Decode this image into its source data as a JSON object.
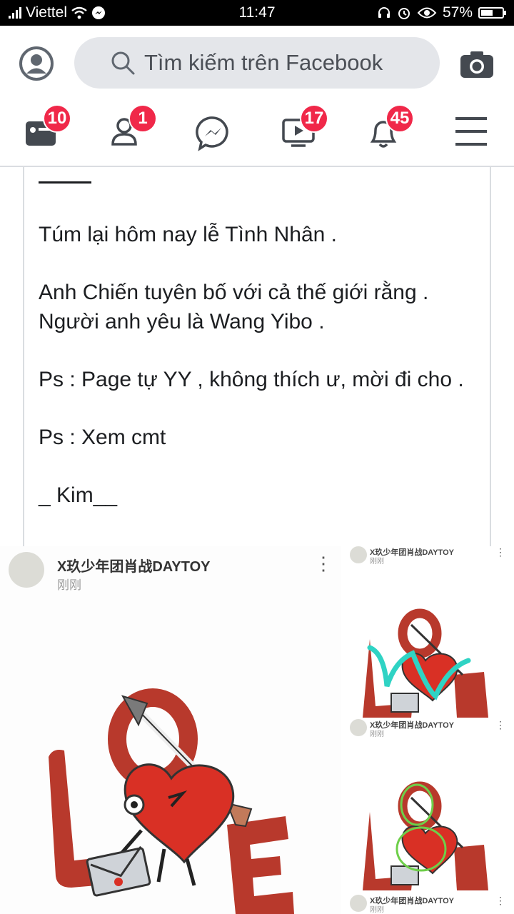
{
  "status_bar": {
    "carrier": "Viettel",
    "time": "11:47",
    "battery_percent": "57%",
    "battery_level": 0.57,
    "icons": [
      "signal-icon",
      "wifi-icon",
      "messenger-status-icon",
      "headset-icon",
      "alarm-icon",
      "eye-icon",
      "battery-icon"
    ]
  },
  "search": {
    "placeholder": "Tìm kiếm trên Facebook"
  },
  "nav": {
    "items": [
      {
        "name": "news-feed",
        "badge": "10"
      },
      {
        "name": "friends",
        "badge": "1"
      },
      {
        "name": "messenger",
        "badge": ""
      },
      {
        "name": "watch",
        "badge": "17"
      },
      {
        "name": "notifications",
        "badge": "45"
      },
      {
        "name": "menu",
        "badge": ""
      }
    ],
    "accent": "#f02849"
  },
  "post": {
    "paragraphs": [
      "Túm lại hôm nay lễ Tình Nhân .",
      "Anh Chiến tuyên bố với cả thế giới rằng .\nNgười anh yêu là Wang Yibo .",
      "Ps : Page tự YY , không thích ư, mời đi cho .",
      "Ps : Xem cmt",
      "_ Kim__"
    ]
  },
  "shared_image": {
    "page_name": "X玖少年团肖战DAYTOY",
    "time": "刚刚",
    "sticker_colors": {
      "heart": "#d93025",
      "letters": "#b8392c",
      "scribble_teal": "#2fd3c4",
      "scribble_green": "#6ecf4a"
    }
  }
}
